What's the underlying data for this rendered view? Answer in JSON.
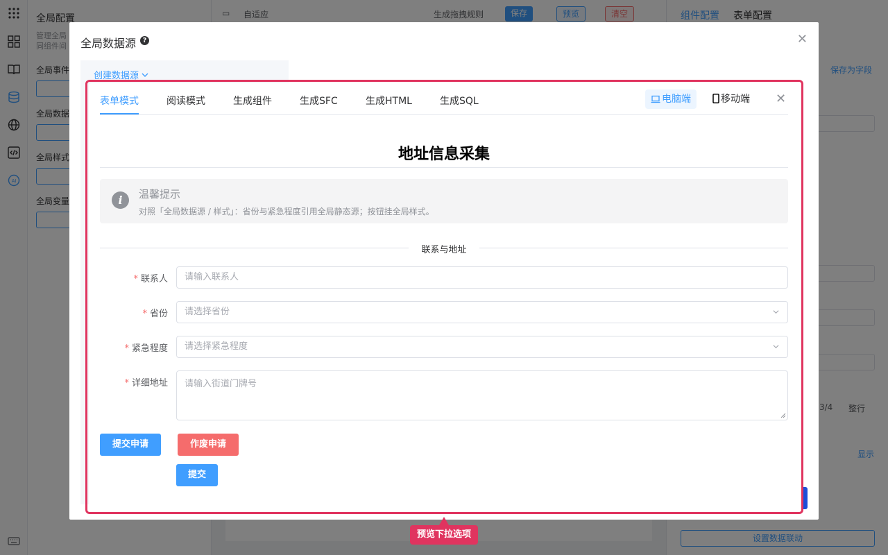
{
  "background": {
    "side_panel": {
      "title": "全局配置",
      "desc_line1": "管理全局",
      "desc_line2": "同组件间",
      "labels": [
        "全局事件",
        "全局数据",
        "全局样式",
        "全局变量"
      ]
    },
    "toolbar": {
      "adaptive": "自适应",
      "drag_rule": "生成拖拽规则",
      "save": "保存",
      "preview": "预览",
      "clear": "清空"
    },
    "right_panel": {
      "tab_component": "组件配置",
      "tab_form": "表单配置",
      "save_as_field": "保存为字段",
      "fraction": "3/4",
      "whole_row": "整行",
      "show": "显示",
      "data_linkage": "设置数据联动"
    }
  },
  "outer_dialog": {
    "title": "全局数据源",
    "help_icon": "question-circle-icon",
    "create_link": "创建数据源"
  },
  "preview": {
    "tabs": [
      "表单模式",
      "阅读模式",
      "生成组件",
      "生成SFC",
      "生成HTML",
      "生成SQL"
    ],
    "active_tab_index": 0,
    "device_pc": "电脑端",
    "device_mobile": "移动端",
    "form_title": "地址信息采集",
    "alert": {
      "title": "温馨提示",
      "description": "对照「全局数据源 / 样式」：省份与紧急程度引用全局静态源；按钮挂全局样式。"
    },
    "divider": "联系与地址",
    "fields": {
      "contact": {
        "label": "联系人",
        "placeholder": "请输入联系人"
      },
      "province": {
        "label": "省份",
        "placeholder": "请选择省份"
      },
      "urgency": {
        "label": "紧急程度",
        "placeholder": "请选择紧急程度"
      },
      "address": {
        "label": "详细地址",
        "placeholder": "请输入街道门牌号"
      }
    },
    "buttons": {
      "submit_application": "提交申请",
      "void_application": "作废申请",
      "submit": "提交"
    }
  },
  "annotation": {
    "tag": "预览下拉选项",
    "color": "#e0345f"
  },
  "colors": {
    "primary": "#409eff",
    "danger": "#f56c6c",
    "required": "#f56c6c"
  }
}
